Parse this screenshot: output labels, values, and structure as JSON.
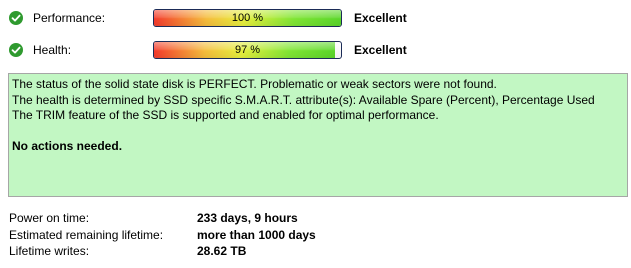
{
  "metrics": [
    {
      "label": "Performance:",
      "value_text": "100 %",
      "value": 100,
      "rating": "Excellent"
    },
    {
      "label": "Health:",
      "value_text": "97 %",
      "value": 97,
      "rating": "Excellent"
    }
  ],
  "status": {
    "lines": [
      "The status of the solid state disk is PERFECT. Problematic or weak sectors were not found.",
      "The health is determined by SSD specific S.M.A.R.T. attribute(s):  Available Spare (Percent), Percentage Used",
      "The TRIM feature of the SSD is supported and enabled for optimal performance."
    ],
    "action": "No actions needed."
  },
  "info": [
    {
      "label": "Power on time:",
      "value": "233 days, 9 hours"
    },
    {
      "label": "Estimated remaining lifetime:",
      "value": "more than 1000 days"
    },
    {
      "label": "Lifetime writes:",
      "value": "28.62 TB"
    }
  ],
  "colors": {
    "status_background": "#c2f7c3",
    "check_icon": "#2f9a2f",
    "bar_border": "#1b2b57"
  },
  "icons": [
    "check-icon"
  ]
}
